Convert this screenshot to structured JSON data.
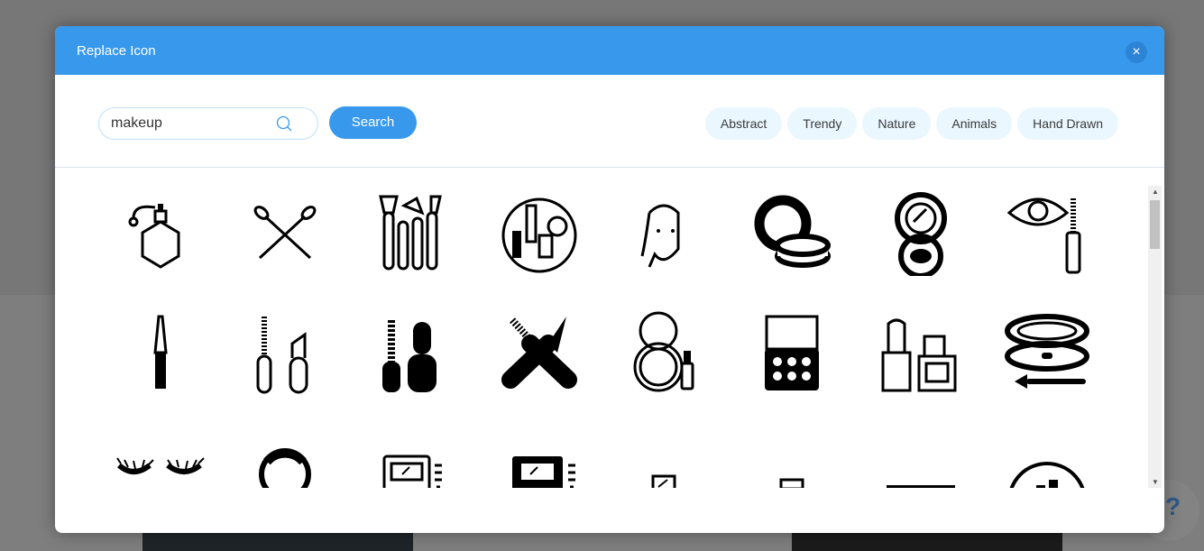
{
  "dialog": {
    "title": "Replace Icon",
    "close_label": "×"
  },
  "search": {
    "value": "makeup",
    "button_label": "Search"
  },
  "tags": [
    "Abstract",
    "Trendy",
    "Nature",
    "Animals",
    "Hand Drawn"
  ],
  "help_label": "?",
  "icons": [
    "perfume-bottle",
    "crossed-brushes",
    "brush-set",
    "makeup-circle",
    "face-mask",
    "compact-powder",
    "compact-mirror",
    "eye-mascara",
    "eyeliner",
    "mascara-lipstick",
    "mascara-lipstick-solid",
    "crossed-mascara-pencil",
    "compact-lipstick",
    "eyeshadow-palette",
    "lipstick-nail-polish",
    "compact-brush",
    "eyelashes",
    "powder-ring",
    "palette-outline",
    "palette-solid",
    "mirror-small",
    "makeup-case",
    "palette-strip",
    "circle-cosmetics"
  ]
}
